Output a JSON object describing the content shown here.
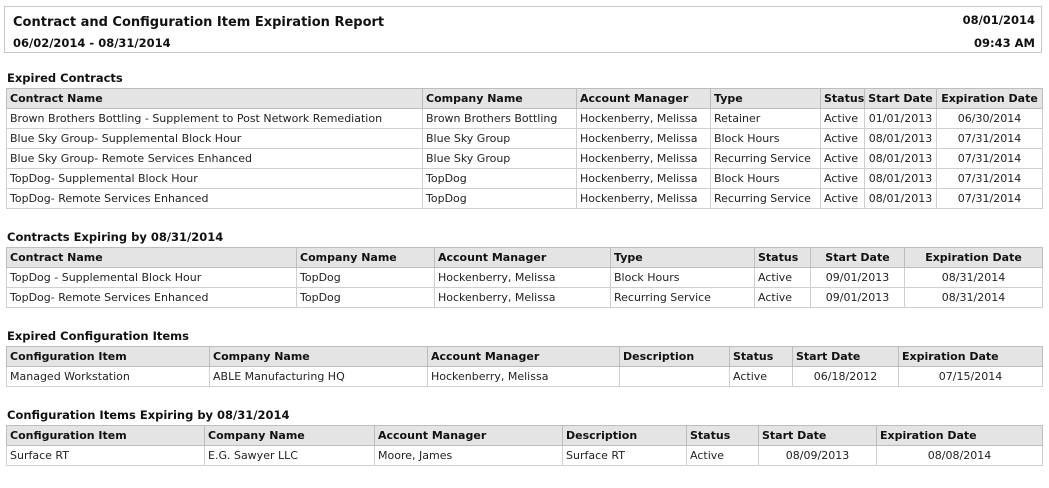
{
  "header": {
    "title": "Contract and Configuration Item Expiration Report",
    "date_range": "06/02/2014 - 08/31/2014",
    "report_date": "08/01/2014",
    "report_time": "09:43 AM"
  },
  "colors": {
    "link": "#2b4f8c",
    "expired": "#c3182c",
    "header_bg": "#e4e4e4"
  },
  "expired_contracts": {
    "title": "Expired Contracts",
    "columns": [
      "Contract Name",
      "Company Name",
      "Account Manager",
      "Type",
      "Status",
      "Start Date",
      "Expiration Date"
    ],
    "rows": [
      [
        "Brown Brothers Bottling - Supplement to Post Network Remediation",
        "Brown Brothers Bottling",
        "Hockenberry, Melissa",
        "Retainer",
        "Active",
        "01/01/2013",
        "06/30/2014"
      ],
      [
        "Blue Sky Group- Supplemental Block Hour",
        "Blue Sky Group",
        "Hockenberry, Melissa",
        "Block Hours",
        "Active",
        "08/01/2013",
        "07/31/2014"
      ],
      [
        "Blue Sky Group- Remote Services Enhanced",
        "Blue Sky Group",
        "Hockenberry, Melissa",
        "Recurring Service",
        "Active",
        "08/01/2013",
        "07/31/2014"
      ],
      [
        "TopDog- Supplemental Block Hour",
        "TopDog",
        "Hockenberry, Melissa",
        "Block Hours",
        "Active",
        "08/01/2013",
        "07/31/2014"
      ],
      [
        "TopDog- Remote Services Enhanced",
        "TopDog",
        "Hockenberry, Melissa",
        "Recurring Service",
        "Active",
        "08/01/2013",
        "07/31/2014"
      ]
    ]
  },
  "expiring_contracts": {
    "title": "Contracts Expiring by 08/31/2014",
    "columns": [
      "Contract Name",
      "Company Name",
      "Account Manager",
      "Type",
      "Status",
      "Start Date",
      "Expiration Date"
    ],
    "rows": [
      [
        "TopDog - Supplemental Block Hour",
        "TopDog",
        "Hockenberry, Melissa",
        "Block Hours",
        "Active",
        "09/01/2013",
        "08/31/2014"
      ],
      [
        "TopDog- Remote Services Enhanced",
        "TopDog",
        "Hockenberry, Melissa",
        "Recurring Service",
        "Active",
        "09/01/2013",
        "08/31/2014"
      ]
    ]
  },
  "expired_config_items": {
    "title": "Expired Configuration Items",
    "columns": [
      "Configuration Item",
      "Company Name",
      "Account Manager",
      "Description",
      "Status",
      "Start Date",
      "Expiration Date"
    ],
    "rows": [
      [
        "Managed Workstation",
        "ABLE Manufacturing HQ",
        "Hockenberry, Melissa",
        "",
        "Active",
        "06/18/2012",
        "07/15/2014"
      ]
    ]
  },
  "expiring_config_items": {
    "title": "Configuration Items Expiring by 08/31/2014",
    "columns": [
      "Configuration Item",
      "Company Name",
      "Account Manager",
      "Description",
      "Status",
      "Start Date",
      "Expiration Date"
    ],
    "rows": [
      [
        "Surface RT",
        "E.G. Sawyer LLC",
        "Moore, James",
        "Surface RT",
        "Active",
        "08/09/2013",
        "08/08/2014"
      ]
    ]
  }
}
